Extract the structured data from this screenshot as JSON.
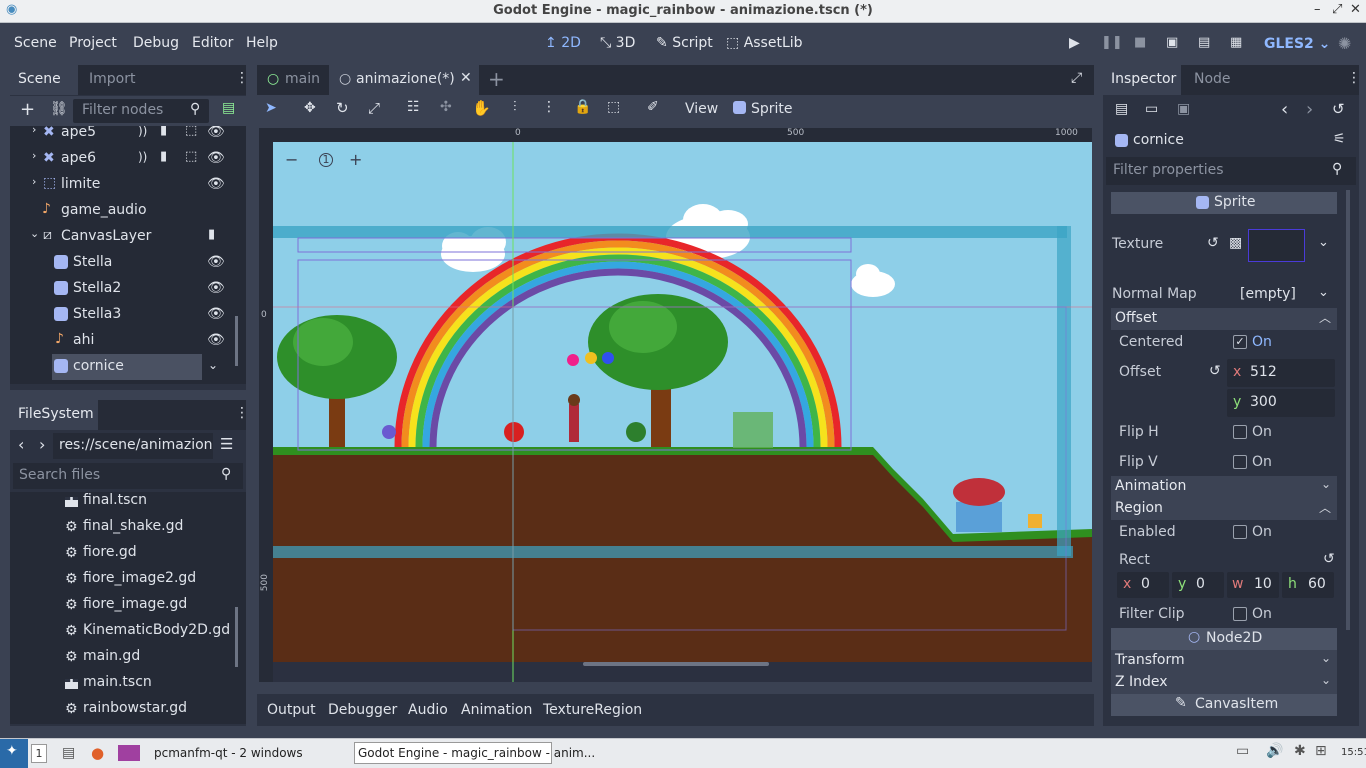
{
  "window": {
    "title": "Godot Engine - magic_rainbow - animazione.tscn (*)",
    "btn_min": "–",
    "btn_max": "⤢",
    "btn_close": "✕"
  },
  "menu": {
    "scene": "Scene",
    "project": "Project",
    "debug": "Debug",
    "editor": "Editor",
    "help": "Help"
  },
  "modes": {
    "m2d": "2D",
    "m3d": "3D",
    "script": "Script",
    "assetlib": "AssetLib"
  },
  "renderer": "GLES2",
  "scene_dock": {
    "tab_scene": "Scene",
    "tab_import": "Import",
    "filter_placeholder": "Filter nodes",
    "nodes": [
      {
        "label": "ape5"
      },
      {
        "label": "ape6"
      },
      {
        "label": "limite"
      },
      {
        "label": "game_audio"
      },
      {
        "label": "CanvasLayer"
      },
      {
        "label": "Stella"
      },
      {
        "label": "Stella2"
      },
      {
        "label": "Stella3"
      },
      {
        "label": "ahi"
      },
      {
        "label": "cornice"
      }
    ]
  },
  "filesystem": {
    "title": "FileSystem",
    "path": "res://scene/animazion",
    "search_placeholder": "Search files",
    "files": [
      "final.tscn",
      "final_shake.gd",
      "fiore.gd",
      "fiore_image2.gd",
      "fiore_image.gd",
      "KinematicBody2D.gd",
      "main.gd",
      "main.tscn",
      "rainbowstar.gd"
    ]
  },
  "editor_tabs": {
    "main": "main",
    "animazione": "animazione(*)"
  },
  "toolbar": {
    "view": "View",
    "sprite": "Sprite"
  },
  "ruler": {
    "t0": "0",
    "t500": "500",
    "t1000": "1000",
    "v0": "0",
    "v500": "500"
  },
  "zoom": {
    "minus": "−",
    "reset": "1",
    "plus": "+"
  },
  "bottom_tabs": [
    "Output",
    "Debugger",
    "Audio",
    "Animation",
    "TextureRegion"
  ],
  "inspector": {
    "tab_inspector": "Inspector",
    "tab_node": "Node",
    "node_name": "cornice",
    "filter_placeholder": "Filter properties",
    "sprite_header": "Sprite",
    "texture_label": "Texture",
    "normal_map_label": "Normal Map",
    "normal_map_value": "[empty]",
    "offset_section": "Offset",
    "centered_label": "Centered",
    "centered_value": "On",
    "offset_label": "Offset",
    "offset_x_label": "x",
    "offset_x": "512",
    "offset_y_label": "y",
    "offset_y": "300",
    "fliph_label": "Flip H",
    "fliph_value": "On",
    "flipv_label": "Flip V",
    "flipv_value": "On",
    "animation_section": "Animation",
    "region_section": "Region",
    "enabled_label": "Enabled",
    "enabled_value": "On",
    "rect_label": "Rect",
    "rect_x_label": "x",
    "rect_x": "0",
    "rect_y_label": "y",
    "rect_y": "0",
    "rect_w_label": "w",
    "rect_w": "10",
    "rect_h_label": "h",
    "rect_h": "60",
    "filterclip_label": "Filter Clip",
    "filterclip_value": "On",
    "node2d_header": "Node2D",
    "transform_section": "Transform",
    "zindex_section": "Z Index",
    "canvasitem_header": "CanvasItem"
  },
  "taskbar": {
    "desktop_num": "1",
    "pcmanfm": "pcmanfm-qt - 2 windows",
    "godot": "Godot Engine - magic_rainbow - anim...",
    "clock": "15:51"
  },
  "colors": {
    "accent": "#8fb8ff",
    "sky": "#8ecfe8",
    "dirt": "#5a2d16",
    "grass": "#2f8f1f"
  }
}
